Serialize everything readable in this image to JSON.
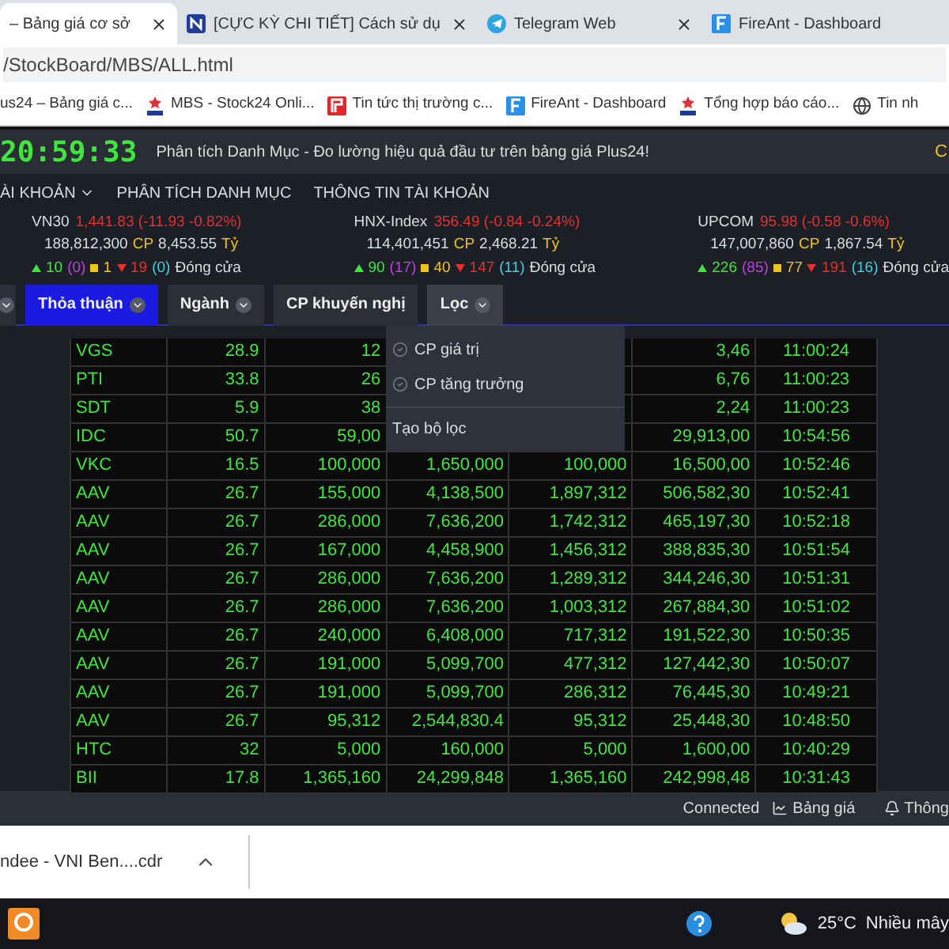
{
  "browser_tabs": [
    {
      "title": "– Bảng giá cơ sở",
      "selected": true
    },
    {
      "title": "[CỰC KỲ CHI TIẾT] Cách sử dụ",
      "selected": false
    },
    {
      "title": "Telegram Web",
      "selected": false
    },
    {
      "title": "FireAnt - Dashboard",
      "selected": false
    }
  ],
  "address": "/StockBoard/MBS/ALL.html",
  "bookmarks": [
    {
      "label": "us24 – Bảng giá c..."
    },
    {
      "label": "MBS - Stock24 Onli..."
    },
    {
      "label": "Tin tức thị trường c..."
    },
    {
      "label": "FireAnt - Dashboard"
    },
    {
      "label": "Tổng hợp báo cáo..."
    },
    {
      "label": "Tin nh"
    }
  ],
  "header": {
    "clock": "20:59:33",
    "marquee": "Phân tích Danh Mục - Đo lường hiệu quả đầu tư trên bảng giá Plus24!",
    "edge_text": "C"
  },
  "menu": [
    {
      "label": "ÀI KHOẢN"
    },
    {
      "label": "PHÂN TÍCH DANH MỤC"
    },
    {
      "label": "THÔNG TIN TÀI KHOẢN"
    }
  ],
  "indices": [
    {
      "name": "VN30",
      "value": "1,441.83 (-11.93 -0.82%)",
      "volume": "188,812,300",
      "volume_unit": "CP",
      "turnover": "8,453.55",
      "turnover_unit": "Tỷ",
      "up": "10",
      "ceiling": "(0)",
      "flat": "1",
      "down": "19",
      "floor": "(0)",
      "status": "Đóng cửa"
    },
    {
      "name": "HNX-Index",
      "value": "356.49 (-0.84 -0.24%)",
      "volume": "114,401,451",
      "volume_unit": "CP",
      "turnover": "2,468.21",
      "turnover_unit": "Tỷ",
      "up": "90",
      "ceiling": "(17)",
      "flat": "40",
      "down": "147",
      "floor": "(11)",
      "status": "Đóng cửa"
    },
    {
      "name": "UPCOM",
      "value": "95.98 (-0.58 -0.6%)",
      "volume": "147,007,860",
      "volume_unit": "CP",
      "turnover": "1,867.54",
      "turnover_unit": "Tỷ",
      "up": "226",
      "ceiling": "(85)",
      "flat": "77",
      "down": "191",
      "floor": "(16)",
      "status": "Đóng cửa"
    }
  ],
  "filters": [
    {
      "selected": false,
      "expanded": false
    },
    {
      "label": "Thỏa thuận",
      "selected": true,
      "expanded": false
    },
    {
      "label": "Ngành",
      "selected": false,
      "expanded": false
    },
    {
      "label": "CP khuyến nghị",
      "selected": false,
      "expanded": false
    },
    {
      "label": "Lọc",
      "selected": false,
      "expanded": true
    }
  ],
  "filter_menu": {
    "options": [
      {
        "label": "CP giá trị",
        "checked": false
      },
      {
        "label": "CP tăng trưởng",
        "checked": false
      }
    ],
    "action": "Tạo bộ lọc"
  },
  "table": {
    "rows": [
      [
        "VGS",
        "28.9",
        "12",
        null,
        null,
        "3,46",
        "11:00:24"
      ],
      [
        "PTI",
        "33.8",
        "26",
        null,
        null,
        "6,76",
        "11:00:23"
      ],
      [
        "SDT",
        "5.9",
        "38",
        null,
        null,
        "2,24",
        "11:00:23"
      ],
      [
        "IDC",
        "50.7",
        "59,00",
        null,
        null,
        "29,913,00",
        "10:54:56"
      ],
      [
        "VKC",
        "16.5",
        "100,000",
        "1,650,000",
        "100,000",
        "16,500,00",
        "10:52:46"
      ],
      [
        "AAV",
        "26.7",
        "155,000",
        "4,138,500",
        "1,897,312",
        "506,582,30",
        "10:52:41"
      ],
      [
        "AAV",
        "26.7",
        "286,000",
        "7,636,200",
        "1,742,312",
        "465,197,30",
        "10:52:18"
      ],
      [
        "AAV",
        "26.7",
        "167,000",
        "4,458,900",
        "1,456,312",
        "388,835,30",
        "10:51:54"
      ],
      [
        "AAV",
        "26.7",
        "286,000",
        "7,636,200",
        "1,289,312",
        "344,246,30",
        "10:51:31"
      ],
      [
        "AAV",
        "26.7",
        "286,000",
        "7,636,200",
        "1,003,312",
        "267,884,30",
        "10:51:02"
      ],
      [
        "AAV",
        "26.7",
        "240,000",
        "6,408,000",
        "717,312",
        "191,522,30",
        "10:50:35"
      ],
      [
        "AAV",
        "26.7",
        "191,000",
        "5,099,700",
        "477,312",
        "127,442,30",
        "10:50:07"
      ],
      [
        "AAV",
        "26.7",
        "191,000",
        "5,099,700",
        "286,312",
        "76,445,30",
        "10:49:21"
      ],
      [
        "AAV",
        "26.7",
        "95,312",
        "2,544,830.4",
        "95,312",
        "25,448,30",
        "10:48:50"
      ],
      [
        "HTC",
        "32",
        "5,000",
        "160,000",
        "5,000",
        "1,600,00",
        "10:40:29"
      ],
      [
        "BII",
        "17.8",
        "1,365,160",
        "24,299,848",
        "1,365,160",
        "242,998,48",
        "10:31:43"
      ]
    ]
  },
  "status_bar": {
    "connection": "Connected",
    "board_link": "Bảng giá",
    "notifications": "Thông"
  },
  "download": {
    "file": "ndee - VNI Ben....cdr"
  },
  "taskbar": {
    "temperature": "25°C",
    "weather": "Nhiều mây"
  }
}
